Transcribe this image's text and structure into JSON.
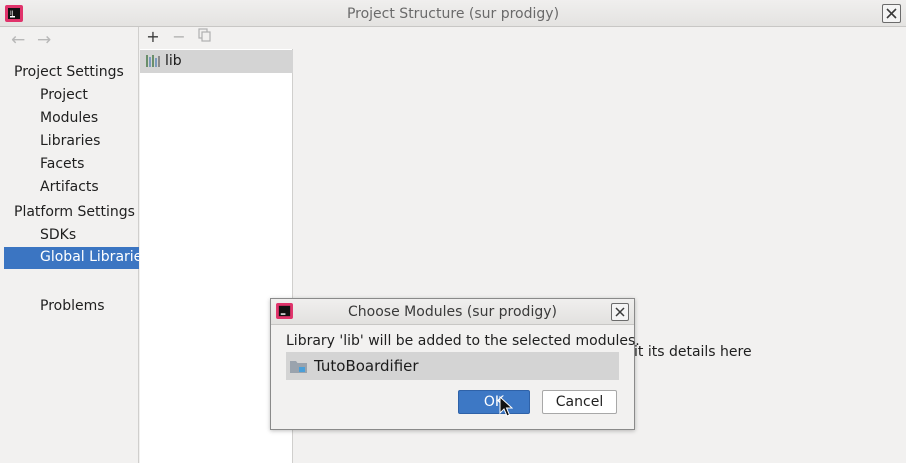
{
  "window": {
    "title": "Project Structure (sur prodigy)"
  },
  "nav": {
    "back_icon": "left-arrow",
    "forward_icon": "right-arrow",
    "sections": [
      {
        "label": "Project Settings",
        "items": [
          "Project",
          "Modules",
          "Libraries",
          "Facets",
          "Artifacts"
        ]
      },
      {
        "label": "Platform Settings",
        "items": [
          "SDKs",
          "Global Libraries"
        ]
      }
    ],
    "extra_items": [
      "Problems"
    ],
    "selected": "Global Libraries"
  },
  "library_list": {
    "toolbar": {
      "add": "+",
      "remove": "−",
      "copy_icon": "copy"
    },
    "items": [
      "lib"
    ]
  },
  "details": {
    "hint_fragment": "it its details here"
  },
  "dialog": {
    "title": "Choose Modules (sur prodigy)",
    "message": "Library 'lib' will be added to the selected modules.",
    "modules": [
      "TutoBoardifier"
    ],
    "ok_label": "OK",
    "cancel_label": "Cancel"
  },
  "colors": {
    "selection": "#3b75c2",
    "ok_button": "#3d78c5",
    "row_highlight": "#d4d4d4"
  }
}
